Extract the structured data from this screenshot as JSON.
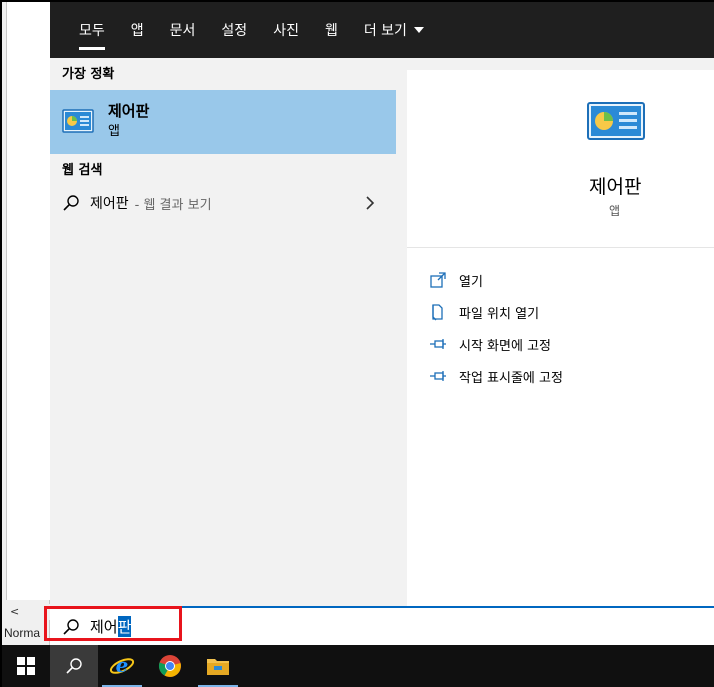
{
  "background_app": {
    "scroll_arrow": "<",
    "status_text": "Norma"
  },
  "tabs": [
    {
      "label": "모두",
      "active": true
    },
    {
      "label": "앱"
    },
    {
      "label": "문서"
    },
    {
      "label": "설정"
    },
    {
      "label": "사진"
    },
    {
      "label": "웹"
    },
    {
      "label": "더 보기"
    }
  ],
  "best_match": {
    "header": "가장 정확",
    "title": "제어판",
    "subtitle": "앱"
  },
  "web_search": {
    "header": "웹 검색",
    "query": "제어판",
    "hint": "- 웹 결과 보기"
  },
  "detail": {
    "title": "제어판",
    "subtitle": "앱",
    "actions": [
      {
        "label": "열기",
        "icon": "open-icon"
      },
      {
        "label": "파일 위치 열기",
        "icon": "file-location-icon"
      },
      {
        "label": "시작 화면에 고정",
        "icon": "pin-icon"
      },
      {
        "label": "작업 표시줄에 고정",
        "icon": "pin-icon"
      }
    ]
  },
  "search_box": {
    "typed": "제어",
    "selected": "판"
  },
  "taskbar": {
    "items": [
      "windows-start-icon",
      "search-icon",
      "internet-explorer-icon",
      "chrome-icon",
      "file-explorer-icon"
    ]
  },
  "colors": {
    "accent": "#0067c0",
    "highlight": "#99c8ea",
    "tab_bar": "#1f1f1f",
    "annotation_red": "#e8141c"
  }
}
